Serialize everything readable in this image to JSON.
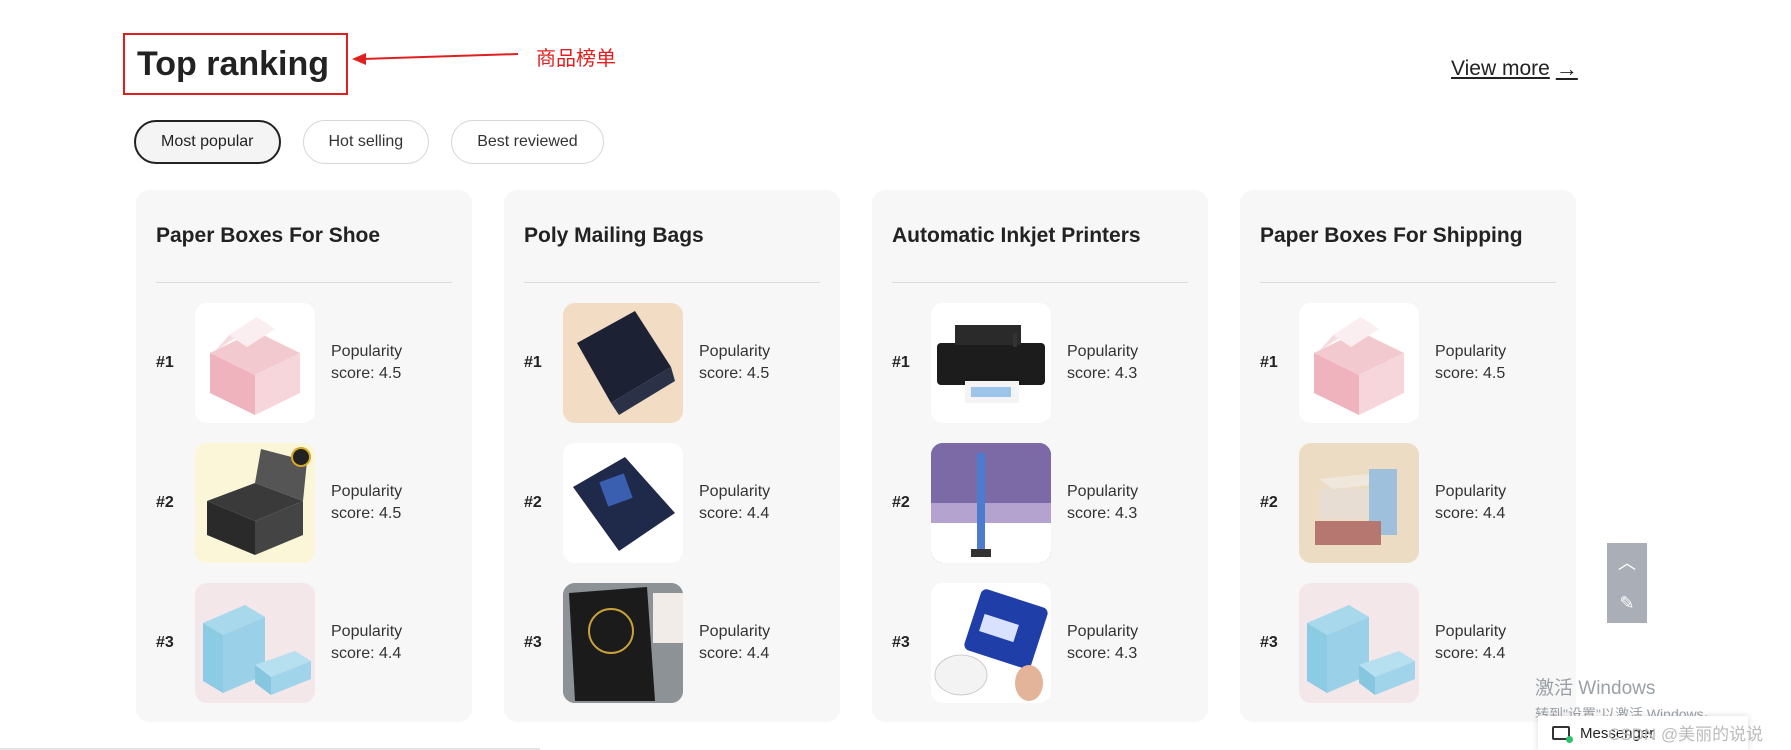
{
  "header": {
    "title": "Top ranking",
    "annotation": "商品榜单",
    "view_more": "View more",
    "view_more_icon": "arrow-right-icon"
  },
  "tabs": [
    {
      "label": "Most popular",
      "active": true
    },
    {
      "label": "Hot selling",
      "active": false
    },
    {
      "label": "Best reviewed",
      "active": false
    }
  ],
  "cards": [
    {
      "title": "Paper Boxes For Shoe",
      "items": [
        {
          "rank": "#1",
          "score_label": "Popularity",
          "score": "score: 4.5"
        },
        {
          "rank": "#2",
          "score_label": "Popularity",
          "score": "score: 4.5"
        },
        {
          "rank": "#3",
          "score_label": "Popularity",
          "score": "score: 4.4"
        }
      ]
    },
    {
      "title": "Poly Mailing Bags",
      "items": [
        {
          "rank": "#1",
          "score_label": "Popularity",
          "score": "score: 4.5"
        },
        {
          "rank": "#2",
          "score_label": "Popularity",
          "score": "score: 4.4"
        },
        {
          "rank": "#3",
          "score_label": "Popularity",
          "score": "score: 4.4"
        }
      ]
    },
    {
      "title": "Automatic Inkjet Printers",
      "items": [
        {
          "rank": "#1",
          "score_label": "Popularity",
          "score": "score: 4.3"
        },
        {
          "rank": "#2",
          "score_label": "Popularity",
          "score": "score: 4.3"
        },
        {
          "rank": "#3",
          "score_label": "Popularity",
          "score": "score: 4.3"
        }
      ]
    },
    {
      "title": "Paper Boxes For Shipping",
      "items": [
        {
          "rank": "#1",
          "score_label": "Popularity",
          "score": "score: 4.5"
        },
        {
          "rank": "#2",
          "score_label": "Popularity",
          "score": "score: 4.4"
        },
        {
          "rank": "#3",
          "score_label": "Popularity",
          "score": "score: 4.4"
        }
      ]
    }
  ],
  "side_widget": {
    "up_icon": "chevron-up-icon",
    "feedback_icon": "feedback-edit-icon"
  },
  "windows": {
    "line1": "激活 Windows",
    "line2": "转到\"设置\"以激活 Windows。"
  },
  "messenger": {
    "label": "Messenger",
    "icon": "chat-icon"
  },
  "watermark": "CSDN @美丽的说说",
  "colors": {
    "annotation": "#e02020",
    "card_bg": "#f7f7f7",
    "online": "#2cc36b"
  }
}
